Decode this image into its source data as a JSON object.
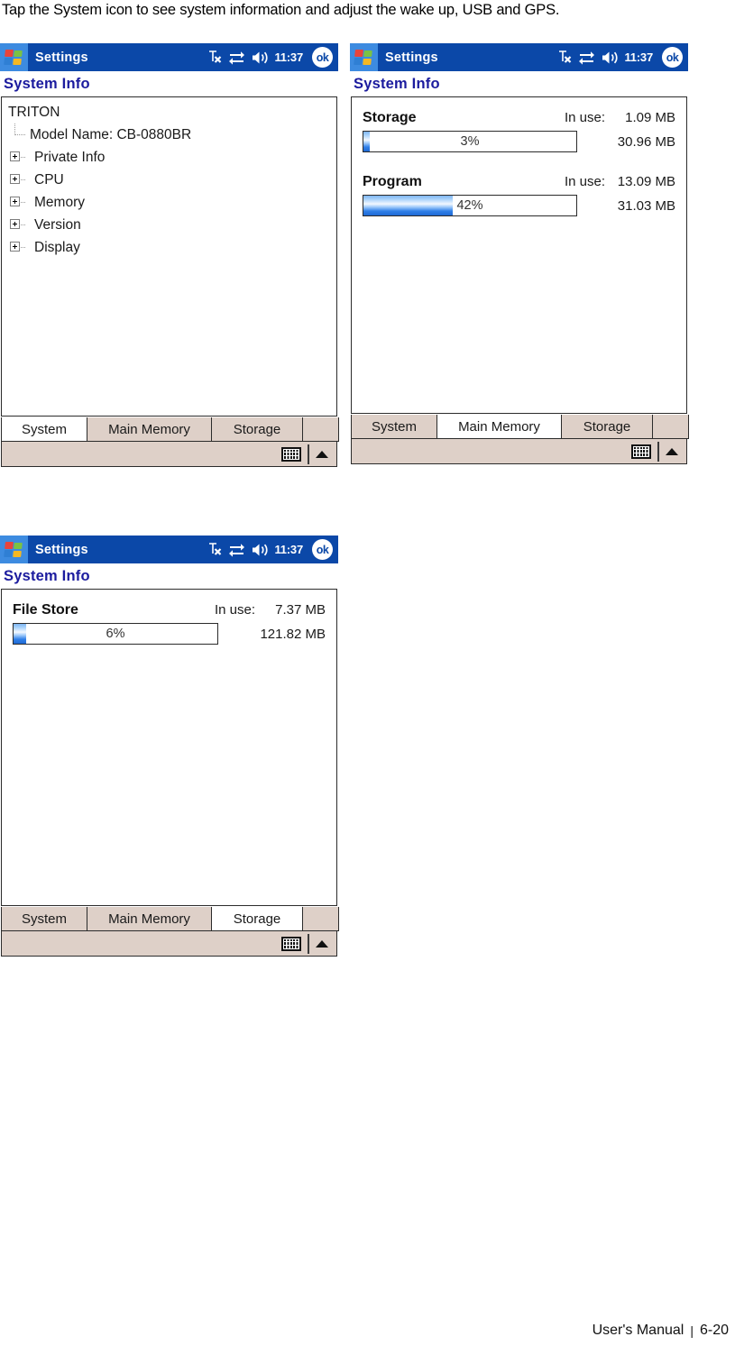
{
  "caption": "Tap the System icon to see system information and adjust the wake up, USB and GPS.",
  "titlebar": {
    "app_title": "Settings",
    "time": "11:37",
    "ok_label": "ok",
    "icons": [
      "signal-off-icon",
      "connectivity-icon",
      "speaker-icon"
    ]
  },
  "page_heading": "System Info",
  "tabs": {
    "system": "System",
    "main_memory": "Main Memory",
    "storage": "Storage"
  },
  "screens": [
    {
      "id": "system-tab-screen",
      "active_tab": "System",
      "tree": {
        "root": "TRITON",
        "nodes": [
          {
            "label": "Model Name: CB-0880BR",
            "type": "leaf"
          },
          {
            "label": "Private Info",
            "type": "expandable"
          },
          {
            "label": "CPU",
            "type": "expandable"
          },
          {
            "label": "Memory",
            "type": "expandable"
          },
          {
            "label": "Version",
            "type": "expandable"
          },
          {
            "label": "Display",
            "type": "expandable"
          }
        ]
      }
    },
    {
      "id": "main-memory-tab-screen",
      "active_tab": "Main Memory",
      "meters": [
        {
          "name": "Storage",
          "in_use_label": "In use:",
          "in_use_value": "1.09 MB",
          "total_value": "30.96 MB",
          "percent_label": "3%",
          "percent": 3
        },
        {
          "name": "Program",
          "in_use_label": "In use:",
          "in_use_value": "13.09 MB",
          "total_value": "31.03 MB",
          "percent_label": "42%",
          "percent": 42
        }
      ]
    },
    {
      "id": "storage-tab-screen",
      "active_tab": "Storage",
      "meters": [
        {
          "name": "File Store",
          "in_use_label": "In use:",
          "in_use_value": "7.37 MB",
          "total_value": "121.82 MB",
          "percent_label": "6%",
          "percent": 6
        }
      ]
    }
  ],
  "footer": {
    "manual_label": "User's Manual",
    "separator": "|",
    "page_number": "6-20"
  },
  "colors": {
    "titlebar_blue": "#0b48a8",
    "start_button_blue": "#3d8be0",
    "heading_navy": "#1b1b9e",
    "chrome_beige": "#ded0c8",
    "bar_blue": "#2f7fe8"
  }
}
